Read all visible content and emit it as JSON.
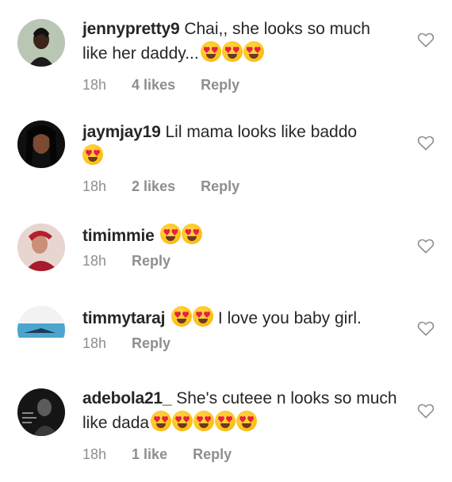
{
  "comments": [
    {
      "username": "jennypretty9",
      "text": "Chai,, she looks so much like her daddy...",
      "emoji_count": 3,
      "time": "18h",
      "likes": "4 likes",
      "reply": "Reply"
    },
    {
      "username": "jaymjay19",
      "text": "Lil mama looks like baddo",
      "emoji_count": 1,
      "time": "18h",
      "likes": "2 likes",
      "reply": "Reply"
    },
    {
      "username": "timimmie",
      "text": "",
      "emoji_count": 2,
      "time": "18h",
      "likes": "",
      "reply": "Reply"
    },
    {
      "username": "timmytaraj",
      "text": "I love you baby girl.",
      "emoji_count": 2,
      "time": "18h",
      "likes": "",
      "reply": "Reply"
    },
    {
      "username": "adebola21_",
      "text": "She's cuteee n looks so much like dada",
      "emoji_count": 5,
      "time": "18h",
      "likes": "1 like",
      "reply": "Reply"
    }
  ],
  "icons": {
    "heart": "heart-outline-icon",
    "emoji": "heart-eyes-emoji-icon"
  },
  "colors": {
    "text": "#262626",
    "meta": "#8e8e8e",
    "emoji_face": "#ffc21a",
    "emoji_heart": "#e8213c"
  }
}
